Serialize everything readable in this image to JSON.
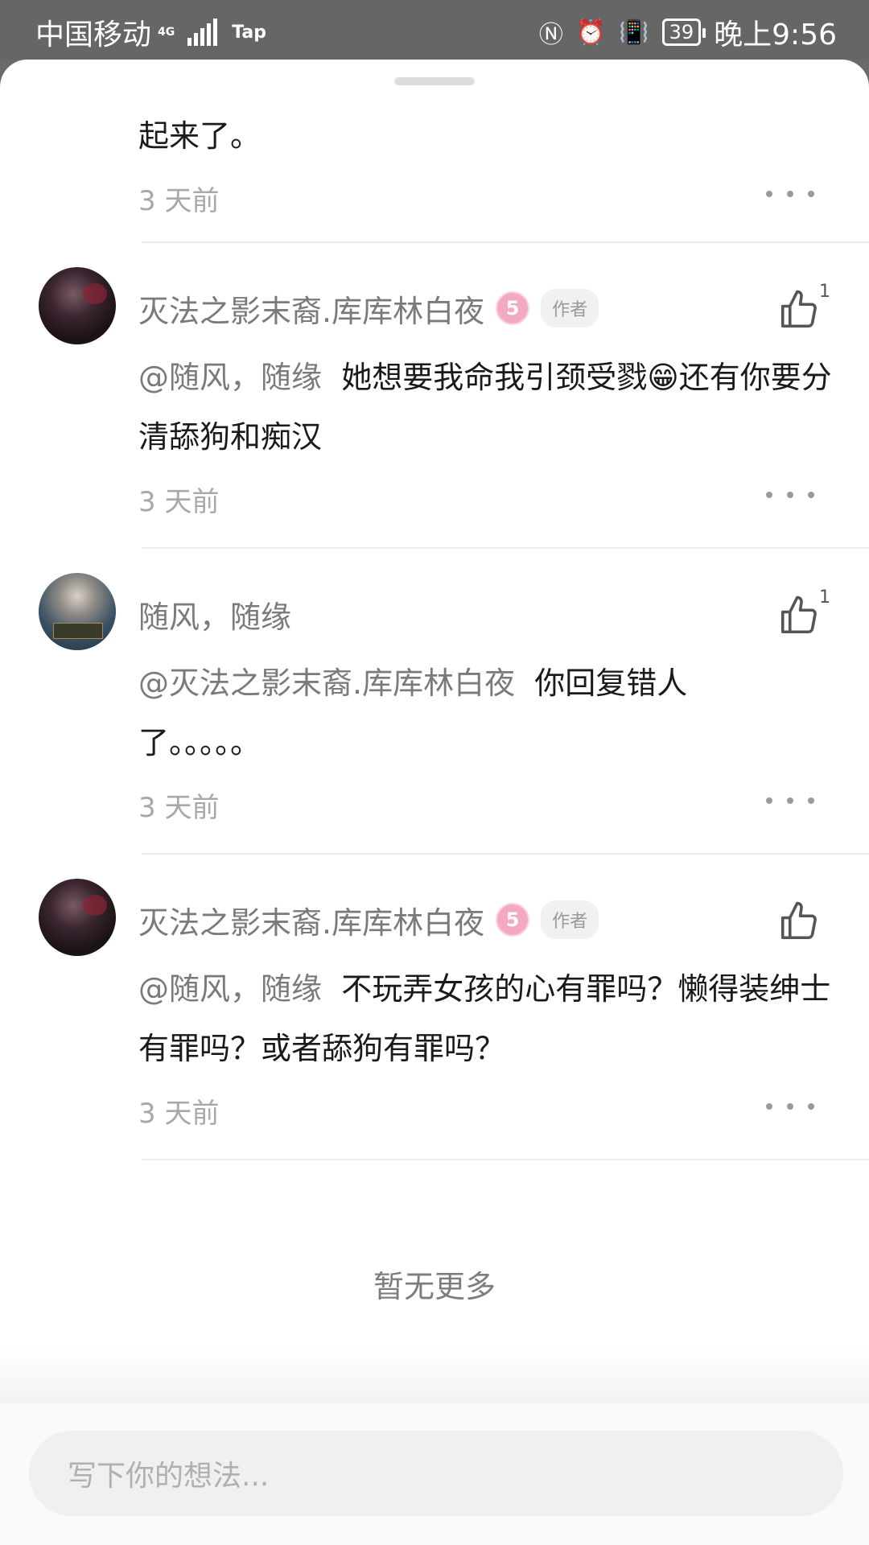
{
  "status_bar": {
    "carrier": "中国移动",
    "network": "4G",
    "app_label": "Tap",
    "battery": "39",
    "time": "晚上9:56"
  },
  "top_partial": {
    "text": "起来了。",
    "time": "3 天前"
  },
  "comments": [
    {
      "username": "灭法之影末裔.库库林白夜",
      "level": "5",
      "author_tag": "作者",
      "like_count": "1",
      "mention": "@随风，随缘",
      "text": "她想要我命我引颈受戮😁还有你要分清舔狗和痴汉",
      "time": "3 天前"
    },
    {
      "username": "随风，随缘",
      "like_count": "1",
      "mention": "@灭法之影末裔.库库林白夜",
      "text": "你回复错人了。。。。。",
      "time": "3 天前"
    },
    {
      "username": "灭法之影末裔.库库林白夜",
      "level": "5",
      "author_tag": "作者",
      "mention": "@随风，随缘",
      "text": "不玩弄女孩的心有罪吗？懒得装绅士有罪吗？或者舔狗有罪吗？",
      "time": "3 天前"
    }
  ],
  "no_more": "暂无更多",
  "input": {
    "placeholder": "写下你的想法..."
  },
  "colors": {
    "level_badge": "#f3aac1",
    "mention": "#7a7a7a",
    "timestamp": "#a8a8a8"
  }
}
